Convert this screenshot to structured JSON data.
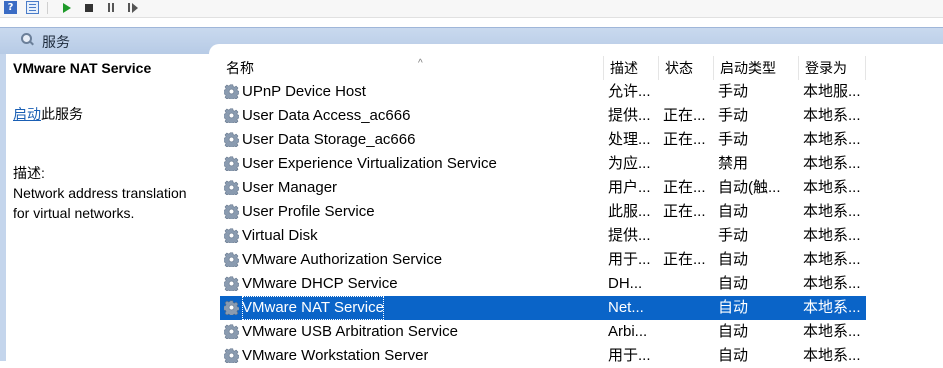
{
  "header": {
    "title": "服务"
  },
  "left_pane": {
    "service_name": "VMware NAT Service",
    "start_link": "启动",
    "start_suffix": "此服务",
    "desc_label": "描述:",
    "desc_text": "Network address translation for virtual networks."
  },
  "columns": {
    "name": "名称",
    "desc": "描述",
    "status": "状态",
    "start_type": "启动类型",
    "logon": "登录为"
  },
  "rows": [
    {
      "name": "UPnP Device Host",
      "desc": "允许...",
      "status": "",
      "start_type": "手动",
      "logon": "本地服..."
    },
    {
      "name": "User Data Access_ac666",
      "desc": "提供...",
      "status": "正在...",
      "start_type": "手动",
      "logon": "本地系..."
    },
    {
      "name": "User Data Storage_ac666",
      "desc": "处理...",
      "status": "正在...",
      "start_type": "手动",
      "logon": "本地系..."
    },
    {
      "name": "User Experience Virtualization Service",
      "desc": "为应...",
      "status": "",
      "start_type": "禁用",
      "logon": "本地系..."
    },
    {
      "name": "User Manager",
      "desc": "用户...",
      "status": "正在...",
      "start_type": "自动(触...",
      "logon": "本地系..."
    },
    {
      "name": "User Profile Service",
      "desc": "此服...",
      "status": "正在...",
      "start_type": "自动",
      "logon": "本地系..."
    },
    {
      "name": "Virtual Disk",
      "desc": "提供...",
      "status": "",
      "start_type": "手动",
      "logon": "本地系..."
    },
    {
      "name": "VMware Authorization Service",
      "desc": "用于...",
      "status": "正在...",
      "start_type": "自动",
      "logon": "本地系..."
    },
    {
      "name": "VMware DHCP Service",
      "desc": "DH...",
      "status": "",
      "start_type": "自动",
      "logon": "本地系..."
    },
    {
      "name": "VMware NAT Service",
      "desc": "Net...",
      "status": "",
      "start_type": "自动",
      "logon": "本地系..."
    },
    {
      "name": "VMware USB Arbitration Service",
      "desc": "Arbi...",
      "status": "",
      "start_type": "自动",
      "logon": "本地系..."
    },
    {
      "name": "VMware Workstation Server",
      "desc": "用于...",
      "status": "",
      "start_type": "自动",
      "logon": "本地系..."
    }
  ],
  "colors": {
    "selection": "#0a64c8",
    "link": "#1a5fb4",
    "header_bar": "#c3d5ec"
  }
}
